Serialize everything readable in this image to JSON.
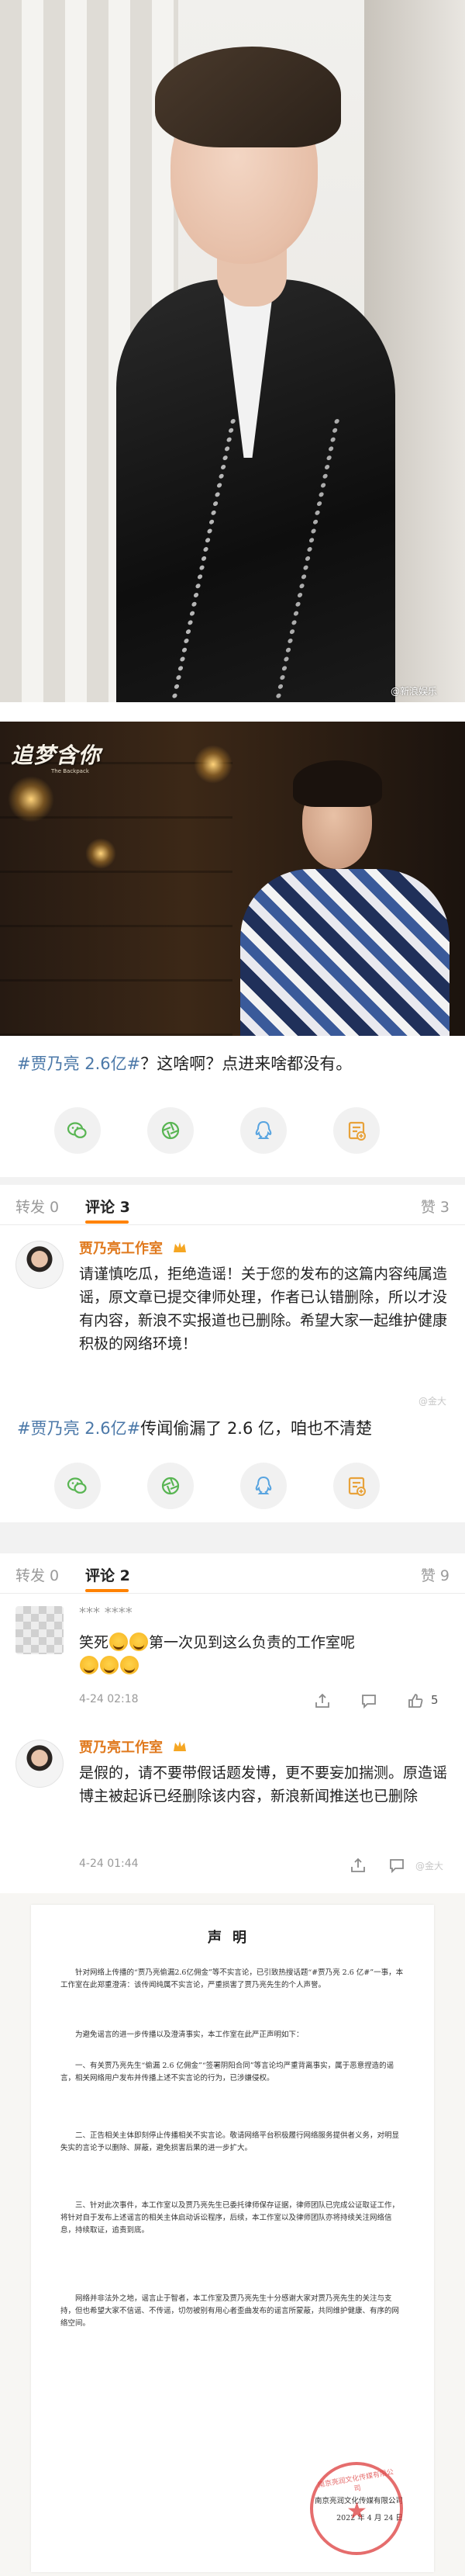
{
  "photo1": {
    "watermark": "@新浪娱乐"
  },
  "photo2": {
    "logo_main": "追梦含你",
    "logo_sub": "The Backpack"
  },
  "post": {
    "hashtag": "#贾乃亮 2.6亿#",
    "text": "？这啥啊？点进来啥都没有。",
    "share_icons": [
      "wechat-icon",
      "moments-icon",
      "qq-icon",
      "save-image-icon"
    ]
  },
  "comments1": {
    "tabs": {
      "repost": "转发 0",
      "comment": "评论 3",
      "like": "赞 3"
    },
    "item": {
      "user": "贾乃亮工作室",
      "text": "请谨慎吃瓜，拒绝造谣！关于您的发布的这篇内容纯属造谣，原文章已提交律师处理，作者已认错删除，所以才没有内容，新浪不实报道也已删除。希望大家一起维护健康积极的网络环境！",
      "watermark": "@金大"
    },
    "post_hashtag": "#贾乃亮 2.6亿#",
    "post_text": "传闻偷漏了 2.6 亿，咱也不清楚",
    "share_icons": [
      "wechat-icon",
      "moments-icon",
      "qq-icon",
      "save-image-icon"
    ]
  },
  "comments2": {
    "tabs": {
      "repost": "转发 0",
      "comment": "评论 2",
      "like": "赞 9"
    },
    "items": [
      {
        "user": "*** ****",
        "text_before": "笑死",
        "text_after": "第一次见到这么负责的工作室呢",
        "time": "4-24 02:18",
        "likes": "5"
      },
      {
        "user": "贾乃亮工作室",
        "text": "是假的，请不要带假话题发博，更不要妄加揣测。原造谣博主被起诉已经删除该内容，新浪新闻推送也已删除",
        "time": "4-24 01:44",
        "watermark": "@金大"
      }
    ]
  },
  "statement": {
    "title": "声明",
    "paragraphs": [
      "针对网络上传播的“贾乃亮偷漏2.6亿佣金”等不实言论，已引致热搜话题“#贾乃亮 2.6 亿#”一事，本工作室在此郑重澄清：该传闻纯属不实言论，严重损害了贾乃亮先生的个人声誉。",
      "为避免谣言的进一步传播以及澄清事实，本工作室在此严正声明如下：",
      "一、有关贾乃亮先生“偷漏 2.6 亿佣金”“签署阴阳合同”等言论均严重背离事实，属于恶意捏造的谣言，相关网络用户发布并传播上述不实言论的行为，已涉嫌侵权。",
      "二、正告相关主体即刻停止传播相关不实言论。敬请网络平台积极履行网络服务提供者义务，对明显失实的言论予以删除、屏蔽，避免损害后果的进一步扩大。",
      "三、针对此次事件，本工作室以及贾乃亮先生已委托律师保存证据，律师团队已完成公证取证工作，将针对自于发布上述谣言的相关主体启动诉讼程序，后续，本工作室以及律师团队亦将持续关注网络信息，持续取证，追责到底。",
      "网络并非法外之地，谣言止于智者，本工作室及贾乃亮先生十分感谢大家对贾乃亮先生的关注与支持，但也希望大家不信谣、不传谣，切勿被别有用心者歪曲发布的谣言所蒙蔽，共同维护健康、有序的网络空间。"
    ],
    "signature": "南京亮润文化传媒有限公司",
    "date": "2022 年 4 月 24 日",
    "seal_text": "南京亮润文化传媒有限公司"
  }
}
